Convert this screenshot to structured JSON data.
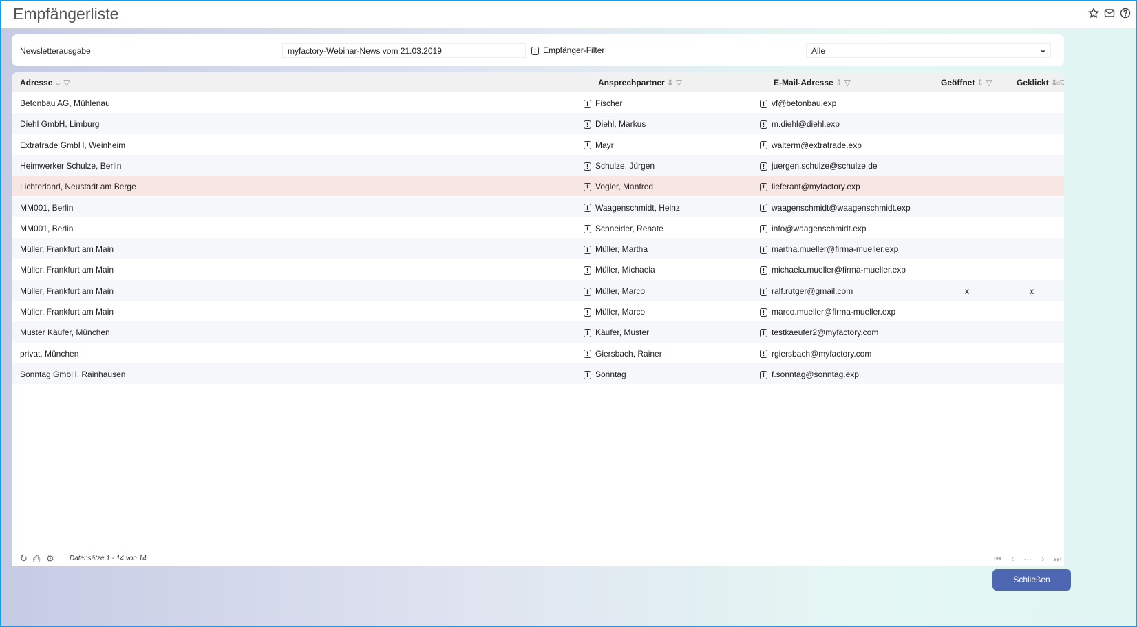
{
  "title": "Empfängerliste",
  "filter": {
    "newsletter_label": "Newsletterausgabe",
    "newsletter_value": "myfactory-Webinar-News vom 21.03.2019",
    "recipient_filter_label": "Empfänger-Filter",
    "recipient_filter_value": "Alle"
  },
  "columns": [
    "Adresse",
    "Ansprechpartner",
    "E-Mail-Adresse",
    "Geöffnet",
    "Geklickt"
  ],
  "rows": [
    {
      "adresse": "Betonbau AG, Mühlenau",
      "partner": "Fischer",
      "email": "vf@betonbau.exp",
      "opened": "",
      "clicked": ""
    },
    {
      "adresse": "Diehl GmbH, Limburg",
      "partner": "Diehl, Markus",
      "email": "m.diehl@diehl.exp",
      "opened": "",
      "clicked": ""
    },
    {
      "adresse": "Extratrade GmbH, Weinheim",
      "partner": "Mayr",
      "email": "walterm@extratrade.exp",
      "opened": "",
      "clicked": ""
    },
    {
      "adresse": "Heimwerker Schulze, Berlin",
      "partner": "Schulze, Jürgen",
      "email": "juergen.schulze@schulze.de",
      "opened": "",
      "clicked": ""
    },
    {
      "adresse": "Lichterland, Neustadt am Berge",
      "partner": "Vogler, Manfred",
      "email": "lieferant@myfactory.exp",
      "opened": "",
      "clicked": ""
    },
    {
      "adresse": "MM001, Berlin",
      "partner": "Waagenschmidt, Heinz",
      "email": "waagenschmidt@waagenschmidt.exp",
      "opened": "",
      "clicked": ""
    },
    {
      "adresse": "MM001, Berlin",
      "partner": "Schneider, Renate",
      "email": "info@waagenschmidt.exp",
      "opened": "",
      "clicked": ""
    },
    {
      "adresse": "Müller, Frankfurt am Main",
      "partner": "Müller, Martha",
      "email": "martha.mueller@firma-mueller.exp",
      "opened": "",
      "clicked": ""
    },
    {
      "adresse": "Müller, Frankfurt am Main",
      "partner": "Müller, Michaela",
      "email": "michaela.mueller@firma-mueller.exp",
      "opened": "",
      "clicked": ""
    },
    {
      "adresse": "Müller, Frankfurt am Main",
      "partner": "Müller, Marco",
      "email": "ralf.rutger@gmail.com",
      "opened": "x",
      "clicked": "x"
    },
    {
      "adresse": "Müller, Frankfurt am Main",
      "partner": "Müller, Marco",
      "email": "marco.mueller@firma-mueller.exp",
      "opened": "",
      "clicked": ""
    },
    {
      "adresse": "Muster Käufer, München",
      "partner": "Käufer, Muster",
      "email": "testkaeufer2@myfactory.com",
      "opened": "",
      "clicked": ""
    },
    {
      "adresse": "privat, München",
      "partner": "Giersbach, Rainer",
      "email": "rgiersbach@myfactory.com",
      "opened": "",
      "clicked": ""
    },
    {
      "adresse": "Sonntag GmbH, Rainhausen",
      "partner": "Sonntag",
      "email": "f.sonntag@sonntag.exp",
      "opened": "",
      "clicked": ""
    }
  ],
  "footer": {
    "count": "Datensätze 1 - 14 von 14",
    "pager_more": "···"
  },
  "close_label": "Schließen"
}
